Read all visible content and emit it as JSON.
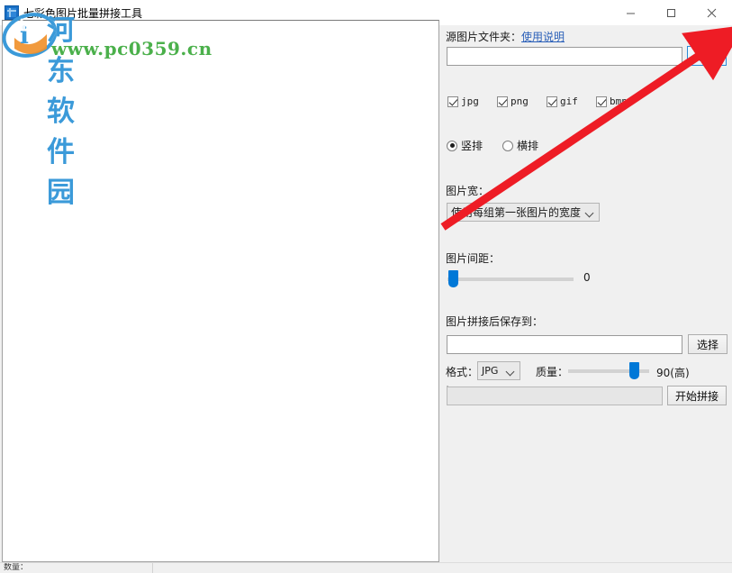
{
  "window": {
    "title": "七彩色图片批量拼接工具",
    "icon": "app-icon",
    "controls": {
      "minimize": "–",
      "maximize": "□",
      "close": "✕"
    }
  },
  "watermark": {
    "site_name": "河东软件园",
    "site_url": "www.pc0359.cn"
  },
  "source": {
    "label": "源图片文件夹：",
    "help_link": "使用说明",
    "path_value": "",
    "path_placeholder": "",
    "choose_button": "选择"
  },
  "filetypes": [
    {
      "label": "jpg",
      "checked": true
    },
    {
      "label": "png",
      "checked": true
    },
    {
      "label": "gif",
      "checked": true
    },
    {
      "label": "bmp",
      "checked": true
    }
  ],
  "layout": {
    "options": [
      {
        "label": "竖排",
        "selected": true
      },
      {
        "label": "横排",
        "selected": false
      }
    ]
  },
  "width": {
    "label": "图片宽：",
    "selected": "使用每组第一张图片的宽度"
  },
  "spacing": {
    "label": "图片间距：",
    "value": "0",
    "percent": 2,
    "min": 0,
    "max": 100
  },
  "output": {
    "label": "图片拼接后保存到：",
    "path_value": "",
    "path_placeholder": "",
    "choose_button": "选择"
  },
  "format": {
    "label": "格式：",
    "selected": "JPG"
  },
  "quality": {
    "label": "质量：",
    "value": "90(高)",
    "percent": 83
  },
  "action": {
    "progress_text": "",
    "start_button": "开始拼接"
  },
  "statusbar": {
    "left_cell": "数量：",
    "right_cell": ""
  },
  "colors": {
    "accent": "#0078d7",
    "link": "#2a5fb8",
    "arrow": "#ee1c25",
    "panel_bg": "#f0f0f0"
  }
}
